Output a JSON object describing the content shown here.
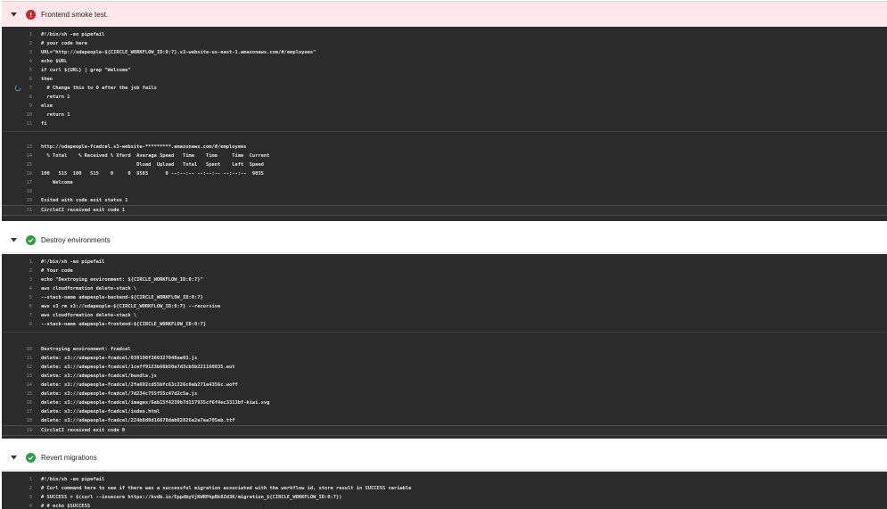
{
  "steps": [
    {
      "title": "Frontend smoke test.",
      "status": "failed",
      "code": [
        {
          "n": "1",
          "t": "#!/bin/sh -eo pipefail"
        },
        {
          "n": "2",
          "t": "# your code here"
        },
        {
          "n": "3",
          "t": "URL=\"http://udapeople-${CIRCLE_WORKFLOW_ID:0:7}.s3-website-us-east-1.amazonaws.com/#/employees\""
        },
        {
          "n": "4",
          "t": "echo $URL"
        },
        {
          "n": "5",
          "t": "if curl ${URL} | grep \"Welcome\""
        },
        {
          "n": "6",
          "t": "then"
        },
        {
          "n": "7",
          "t": "  # Change this to 0 after the job fails"
        },
        {
          "n": "8",
          "t": "  return 1"
        },
        {
          "n": "9",
          "t": "else"
        },
        {
          "n": "10",
          "t": "  return 1"
        },
        {
          "n": "11",
          "t": "fi"
        }
      ],
      "output": [
        {
          "n": "13",
          "t": "http://udapeople-fcadcel.s3-website-*********.amazonaws.com/#/employees"
        },
        {
          "n": "14",
          "t": "  % Total    % Received % Xferd  Average Speed   Time    Time     Time  Current"
        },
        {
          "n": "15",
          "t": "                                 Dload  Upload   Total   Spent    Left  Speed"
        },
        {
          "n": "16",
          "t": "100   515  100   515    0     0  8583      0 --:--:-- --:--:-- --:--:--  9035"
        },
        {
          "n": "17",
          "t": "    Welcome"
        },
        {
          "n": "18",
          "t": ""
        },
        {
          "n": "19",
          "t": "Exited with code exit status 1"
        }
      ],
      "final": {
        "n": "21",
        "t": "CircleCI received exit code 1"
      }
    },
    {
      "title": "Destroy environments",
      "status": "success",
      "code": [
        {
          "n": "1",
          "t": "#!/bin/sh -eo pipefail"
        },
        {
          "n": "2",
          "t": "# Your code"
        },
        {
          "n": "3",
          "t": "echo \"Destroying environment: ${CIRCLE_WORKFLOW_ID:0:7}\""
        },
        {
          "n": "4",
          "t": "aws cloudformation delete-stack \\"
        },
        {
          "n": "5",
          "t": "--stack-name udapeople-backend-${CIRCLE_WORKFLOW_ID:0:7}"
        },
        {
          "n": "6",
          "t": "aws s3 rm s3://udapeople-${CIRCLE_WORKFLOW_ID:0:7} --recursive"
        },
        {
          "n": "7",
          "t": "aws cloudformation delete-stack \\"
        },
        {
          "n": "8",
          "t": "--stack-name udapeople-frontend-${CIRCLE_WORKFLOW_ID:0:7}"
        }
      ],
      "output": [
        {
          "n": "10",
          "t": "Destroying environment: fcadcel"
        },
        {
          "n": "11",
          "t": "delete: s3://udapeople-fcadcel/039190f360327048ee03.js"
        },
        {
          "n": "12",
          "t": "delete: s3://udapeople-fcadcel/1ceff9123b66b50a7d3cb5b221160835.eot"
        },
        {
          "n": "13",
          "t": "delete: s3://udapeople-fcadcel/bundle.js"
        },
        {
          "n": "14",
          "t": "delete: s3://udapeople-fcadcel/2fa692cd55bfc63c226c0eb271e4356c.woff"
        },
        {
          "n": "15",
          "t": "delete: s3://udapeople-fcadcel/7d234c755f55c47d2c5a.js"
        },
        {
          "n": "16",
          "t": "delete: s3://udapeople-fcadcel/images/6eb15f4239b7d157935cf6f4ec3313bf-kiwi.svg"
        },
        {
          "n": "17",
          "t": "delete: s3://udapeople-fcadcel/index.html"
        },
        {
          "n": "18",
          "t": "delete: s3://udapeople-fcadcel/224b8d9d16678dab02826a2a7ea705eb.ttf"
        }
      ],
      "final": {
        "n": "19",
        "t": "CircleCI received exit code 0"
      }
    },
    {
      "title": "Revert migrations",
      "status": "success",
      "code": [
        {
          "n": "1",
          "t": "#!/bin/sh -eo pipefail"
        },
        {
          "n": "2",
          "t": "# Curl command here to see if there was a successful migration associated with the workflow id, store result in SUCCESS variable"
        },
        {
          "n": "3",
          "t": "# SUCCESS = $(curl --insecure https://kvdb.io/EppdbyVjKWRPhpBk8Zd3K/migration_${CIRCLE_WORKFLOW_ID:0:7})"
        },
        {
          "n": "4",
          "t": "# # echo $SUCCESS"
        }
      ],
      "output": [],
      "final": null
    }
  ],
  "colors": {
    "failed_bg": "#fde7ea",
    "fail_icon": "#d4202c",
    "success_icon": "#2f9b46",
    "console_bg": "#2b2b2b"
  }
}
